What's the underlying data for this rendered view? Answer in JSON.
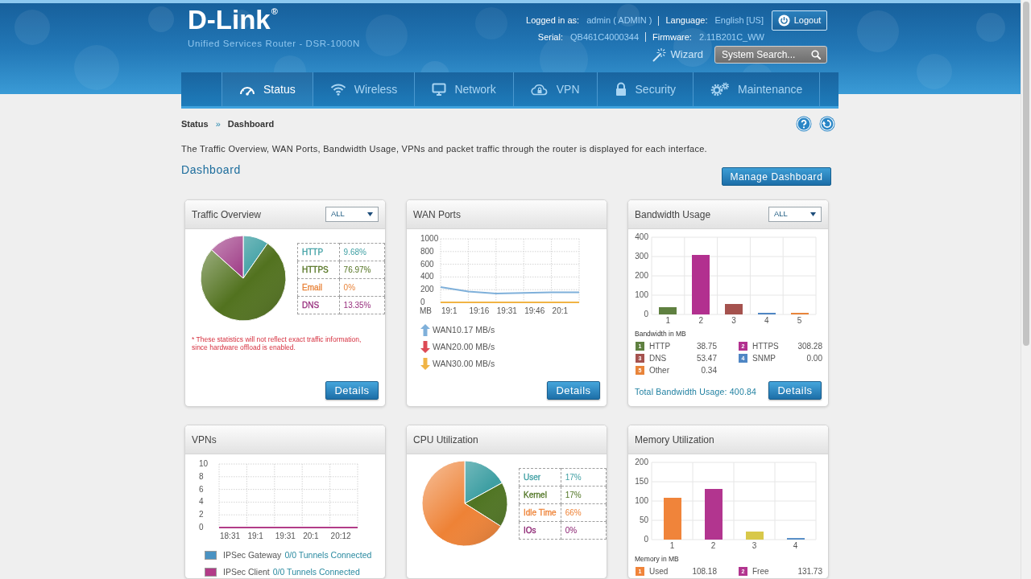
{
  "header": {
    "logo": "D-Link$^{®}$",
    "product": "Unified Services Router - DSR-1000N",
    "account": [
      {
        "label": "Logged in as:",
        "value": "admin ( ADMIN )"
      },
      {
        "label": "Language:",
        "value": "English [US]"
      }
    ],
    "device": [
      {
        "label": "Serial:",
        "value": "QB461C4000344"
      },
      {
        "label": "Firmware:",
        "value": "2.11B201C_WW"
      }
    ],
    "logout_button": "Logout",
    "wizard_link": "Wizard",
    "search": {
      "placeholder": "System Search..."
    }
  },
  "nav": [
    {
      "label": "Status",
      "selected": true
    },
    {
      "label": "Wireless",
      "selected": false
    },
    {
      "label": "Network",
      "selected": false
    },
    {
      "label": "VPN",
      "selected": false
    },
    {
      "label": "Security",
      "selected": false
    },
    {
      "label": "Maintenance",
      "selected": false
    }
  ],
  "breadcrumb": {
    "items": [
      "Status",
      "Dashboard"
    ],
    "separator": "»"
  },
  "description": "The Traffic Overview, WAN Ports, Bandwidth Usage, VPNs and packet traffic through the router is displayed for each interface.",
  "title": "Dashboard",
  "manage_button": "Manage Dashboard",
  "cards": [
    {
      "title": "Traffic Overview",
      "filter": "ALL",
      "chart_data": {
        "type": "pie",
        "categories": [
          "HTTP",
          "HTTPS",
          "Email",
          "DNS"
        ],
        "values": [
          9.68,
          76.97,
          0,
          13.35
        ]
      },
      "rows": [
        {
          "value": "9.68%",
          "color": "#3e9fa3"
        },
        {
          "value": "76.97%",
          "color": "#52721f"
        },
        {
          "value": "0%",
          "color": "#e8843a"
        },
        {
          "value": "13.35%",
          "color": "#982f7e"
        }
      ],
      "note": "* These statistics will not reflect exact traffic information, since hardware offload is enabled.",
      "button": "Details"
    },
    {
      "title": "WAN Ports",
      "chart_data": {
        "type": "line",
        "ylabel": "MB",
        "categories": [
          "19:1",
          "19:16",
          "19:31",
          "19:46",
          "20:1",
          null
        ],
        "ylim": [
          0,
          1000
        ],
        "yticks": [
          0,
          200,
          400,
          600,
          800,
          1000
        ],
        "grid": true,
        "series": [
          {
            "name": "WAN1",
            "color": "#7fb0da",
            "values": [
              240,
              170,
              140,
              150,
              160,
              160
            ]
          },
          {
            "name": "WAN2",
            "color": "#dd4a55",
            "values": [
              null,
              null,
              null,
              null,
              null,
              null
            ]
          },
          {
            "name": "WAN3",
            "color": "#f0b445",
            "values": [
              0,
              0,
              0,
              0,
              0,
              0
            ]
          }
        ]
      },
      "legend": [
        {
          "kind": "up-arrow",
          "rate": "0.17 MB/s"
        },
        {
          "kind": "down-arrow",
          "rate": "0.00 MB/s"
        },
        {
          "kind": "down-arrow",
          "rate": "0.00 MB/s"
        }
      ],
      "button": "Details"
    },
    {
      "title": "Bandwidth Usage",
      "filter": "ALL",
      "chart_data": {
        "type": "bar",
        "categories": [
          "1",
          "2",
          "3",
          "4",
          "5"
        ],
        "ylim": [
          0,
          400
        ],
        "yticks": [
          0,
          100,
          200,
          300,
          400
        ],
        "grid": true,
        "series": [
          {
            "name": "Bandwidth in MB",
            "values": [
              39,
              308,
              53,
              0,
              0
            ]
          }
        ]
      },
      "bars": [
        {
          "color": "#5f8040"
        },
        {
          "color": "#b2308f"
        },
        {
          "color": "#a5524e"
        },
        {
          "color": "#4f86c4"
        },
        {
          "color": "#e8843a"
        }
      ],
      "legend": [
        {
          "index": "1",
          "label": "HTTP",
          "value": "38.75",
          "color": "#5f8040"
        },
        {
          "index": "2",
          "label": "HTTPS",
          "value": "308.28",
          "color": "#b2308f"
        },
        {
          "index": "3",
          "label": "DNS",
          "value": "53.47",
          "color": "#a5524e"
        },
        {
          "index": "4",
          "label": "SNMP",
          "value": "0.00",
          "color": "#4f86c4"
        },
        {
          "index": "5",
          "label": "Other",
          "value": "0.34",
          "color": "#e8843a"
        }
      ],
      "total": "Total Bandwidth Usage: 400.84",
      "button": "Details"
    },
    {
      "title": "VPNs",
      "chart_data": {
        "type": "line",
        "categories": [
          "18:31",
          "19:1",
          "19:31",
          "20:1",
          "20:12",
          null
        ],
        "ylim": [
          0,
          10
        ],
        "yticks": [
          0,
          2,
          4,
          6,
          8,
          10
        ],
        "grid": true,
        "series": [
          {
            "name": "IPSec Gateway",
            "color": "#4a92c2",
            "values": [
              null,
              null,
              null,
              null,
              null,
              null
            ]
          },
          {
            "name": "IPSec Client",
            "color": "#b23c88",
            "values": [
              0,
              0,
              0,
              0,
              0,
              0
            ]
          }
        ]
      },
      "legend": [
        {
          "kind": "swatch",
          "status": "0/0 Tunnels Connected"
        },
        {
          "kind": "swatch",
          "status": "0/0 Tunnels Connected"
        }
      ]
    },
    {
      "title": "CPU Utilization",
      "chart_data": {
        "type": "pie",
        "categories": [
          "User",
          "Kernel",
          "Idle Time",
          "IOs"
        ],
        "values": [
          17,
          17,
          66,
          0
        ]
      },
      "rows": [
        {
          "value": "17%",
          "color": "#3e9fa3"
        },
        {
          "value": "17%",
          "color": "#4f7422"
        },
        {
          "value": "66%",
          "color": "#ee8236"
        },
        {
          "value": "0%",
          "color": "#8a2070"
        }
      ]
    },
    {
      "title": "Memory Utilization",
      "chart_data": {
        "type": "bar",
        "categories": [
          "1",
          "2",
          "3",
          "4"
        ],
        "ylim": [
          0,
          200
        ],
        "yticks": [
          0,
          50,
          100,
          150,
          200
        ],
        "grid": true,
        "series": [
          {
            "name": "Memory in MB",
            "values": [
              108,
              132,
              20,
              2
            ]
          }
        ]
      },
      "bars": [
        {
          "color": "#f0843a"
        },
        {
          "color": "#b2358f"
        },
        {
          "color": "#d8c84a"
        },
        {
          "color": "#5a90c8"
        }
      ],
      "legend": [
        {
          "index": "1",
          "label": "Used",
          "value": "108.18",
          "color": "#f0843a"
        },
        {
          "index": "2",
          "label": "Free",
          "value": "131.73",
          "color": "#b2358f"
        }
      ]
    }
  ]
}
